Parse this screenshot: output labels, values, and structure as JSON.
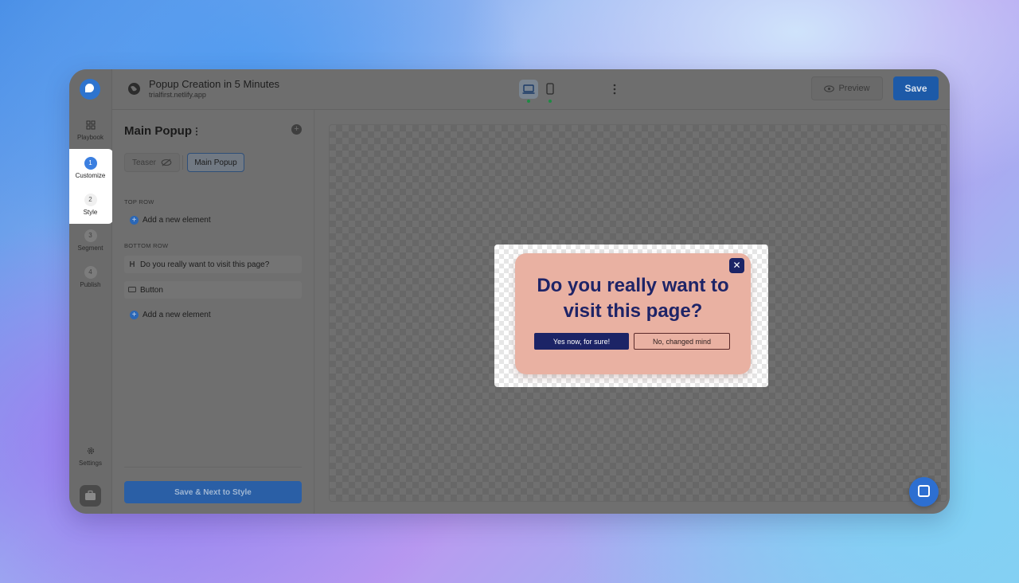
{
  "app": {
    "title": "Popup Creation in 5 Minutes",
    "subtitle": "trialfirst.netlify.app"
  },
  "rail": {
    "playbook": "Playbook",
    "steps": [
      {
        "number": "1",
        "label": "Customize"
      },
      {
        "number": "2",
        "label": "Style"
      },
      {
        "number": "3",
        "label": "Segment"
      },
      {
        "number": "4",
        "label": "Publish"
      }
    ],
    "settings": "Settings"
  },
  "topbar": {
    "preview_label": "Preview",
    "save_label": "Save"
  },
  "panel": {
    "title": "Main Popup",
    "tabs": [
      {
        "label": "Teaser"
      },
      {
        "label": "Main Popup"
      }
    ],
    "top_row_label": "TOP ROW",
    "bottom_row_label": "BOTTOM ROW",
    "add_element_label": "Add a new element",
    "elements": [
      {
        "icon": "H",
        "label": "Do you really want to visit this page?"
      },
      {
        "icon": "button-icon",
        "label": "Button"
      }
    ],
    "save_next_label": "Save & Next to Style"
  },
  "popup": {
    "close_glyph": "✕",
    "heading": "Do you really want to visit this page?",
    "yes_label": "Yes now, for sure!",
    "no_label": "No, changed mind"
  },
  "colors": {
    "accent": "#2e74cf",
    "popup_bg": "#e9b1a2",
    "popup_text": "#1e2467",
    "save_button": "#1d5aa8"
  }
}
